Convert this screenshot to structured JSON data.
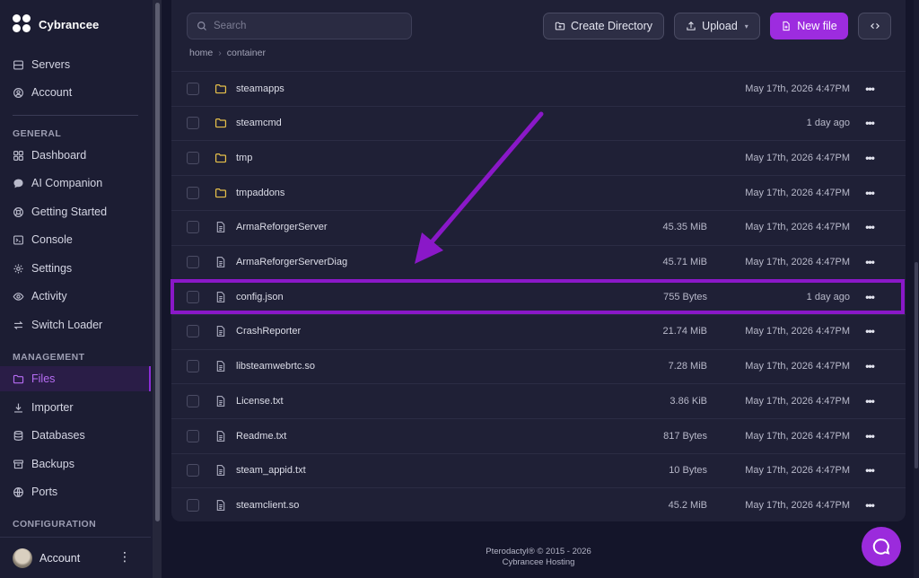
{
  "brand": {
    "name": "Cybrancee"
  },
  "nav_top": [
    {
      "label": "Servers",
      "icon": "server-icon"
    },
    {
      "label": "Account",
      "icon": "user-circle-icon"
    }
  ],
  "sections": {
    "general": "GENERAL",
    "management": "MANAGEMENT",
    "configuration": "CONFIGURATION"
  },
  "nav_general": [
    {
      "label": "Dashboard",
      "icon": "grid-icon"
    },
    {
      "label": "AI Companion",
      "icon": "chat-icon"
    },
    {
      "label": "Getting Started",
      "icon": "lifebuoy-icon"
    },
    {
      "label": "Console",
      "icon": "terminal-icon"
    },
    {
      "label": "Settings",
      "icon": "gear-icon"
    },
    {
      "label": "Activity",
      "icon": "eye-icon"
    },
    {
      "label": "Switch Loader",
      "icon": "swap-icon"
    }
  ],
  "nav_management": [
    {
      "label": "Files",
      "icon": "folder-icon",
      "active": true
    },
    {
      "label": "Importer",
      "icon": "download-icon"
    },
    {
      "label": "Databases",
      "icon": "database-icon"
    },
    {
      "label": "Backups",
      "icon": "archive-icon"
    },
    {
      "label": "Ports",
      "icon": "globe-icon"
    }
  ],
  "account_bottom": {
    "label": "Account"
  },
  "toolbar": {
    "search_placeholder": "Search",
    "create_directory": "Create Directory",
    "upload": "Upload",
    "new_file": "New file"
  },
  "breadcrumb": [
    "home",
    "container"
  ],
  "files": [
    {
      "name": "steamapps",
      "type": "folder",
      "size": "",
      "modified": "May 17th, 2026 4:47PM"
    },
    {
      "name": "steamcmd",
      "type": "folder",
      "size": "",
      "modified": "1 day ago"
    },
    {
      "name": "tmp",
      "type": "folder",
      "size": "",
      "modified": "May 17th, 2026 4:47PM"
    },
    {
      "name": "tmpaddons",
      "type": "folder",
      "size": "",
      "modified": "May 17th, 2026 4:47PM"
    },
    {
      "name": "ArmaReforgerServer",
      "type": "file",
      "size": "45.35 MiB",
      "modified": "May 17th, 2026 4:47PM"
    },
    {
      "name": "ArmaReforgerServerDiag",
      "type": "file",
      "size": "45.71 MiB",
      "modified": "May 17th, 2026 4:47PM"
    },
    {
      "name": "config.json",
      "type": "file",
      "size": "755 Bytes",
      "modified": "1 day ago",
      "highlighted": true
    },
    {
      "name": "CrashReporter",
      "type": "file",
      "size": "21.74 MiB",
      "modified": "May 17th, 2026 4:47PM"
    },
    {
      "name": "libsteamwebrtc.so",
      "type": "file",
      "size": "7.28 MiB",
      "modified": "May 17th, 2026 4:47PM"
    },
    {
      "name": "License.txt",
      "type": "file",
      "size": "3.86 KiB",
      "modified": "May 17th, 2026 4:47PM"
    },
    {
      "name": "Readme.txt",
      "type": "file",
      "size": "817 Bytes",
      "modified": "May 17th, 2026 4:47PM"
    },
    {
      "name": "steam_appid.txt",
      "type": "file",
      "size": "10 Bytes",
      "modified": "May 17th, 2026 4:47PM"
    },
    {
      "name": "steamclient.so",
      "type": "file",
      "size": "45.2 MiB",
      "modified": "May 17th, 2026 4:47PM"
    }
  ],
  "footer": {
    "line1": "Pterodactyl® © 2015 - 2026",
    "line2": "Cybrancee Hosting"
  },
  "colors": {
    "accent": "#9d2cdf",
    "highlight_border": "#8a18c8",
    "folder": "#e8c14a",
    "background": "#14152a",
    "panel": "#1f2036"
  }
}
